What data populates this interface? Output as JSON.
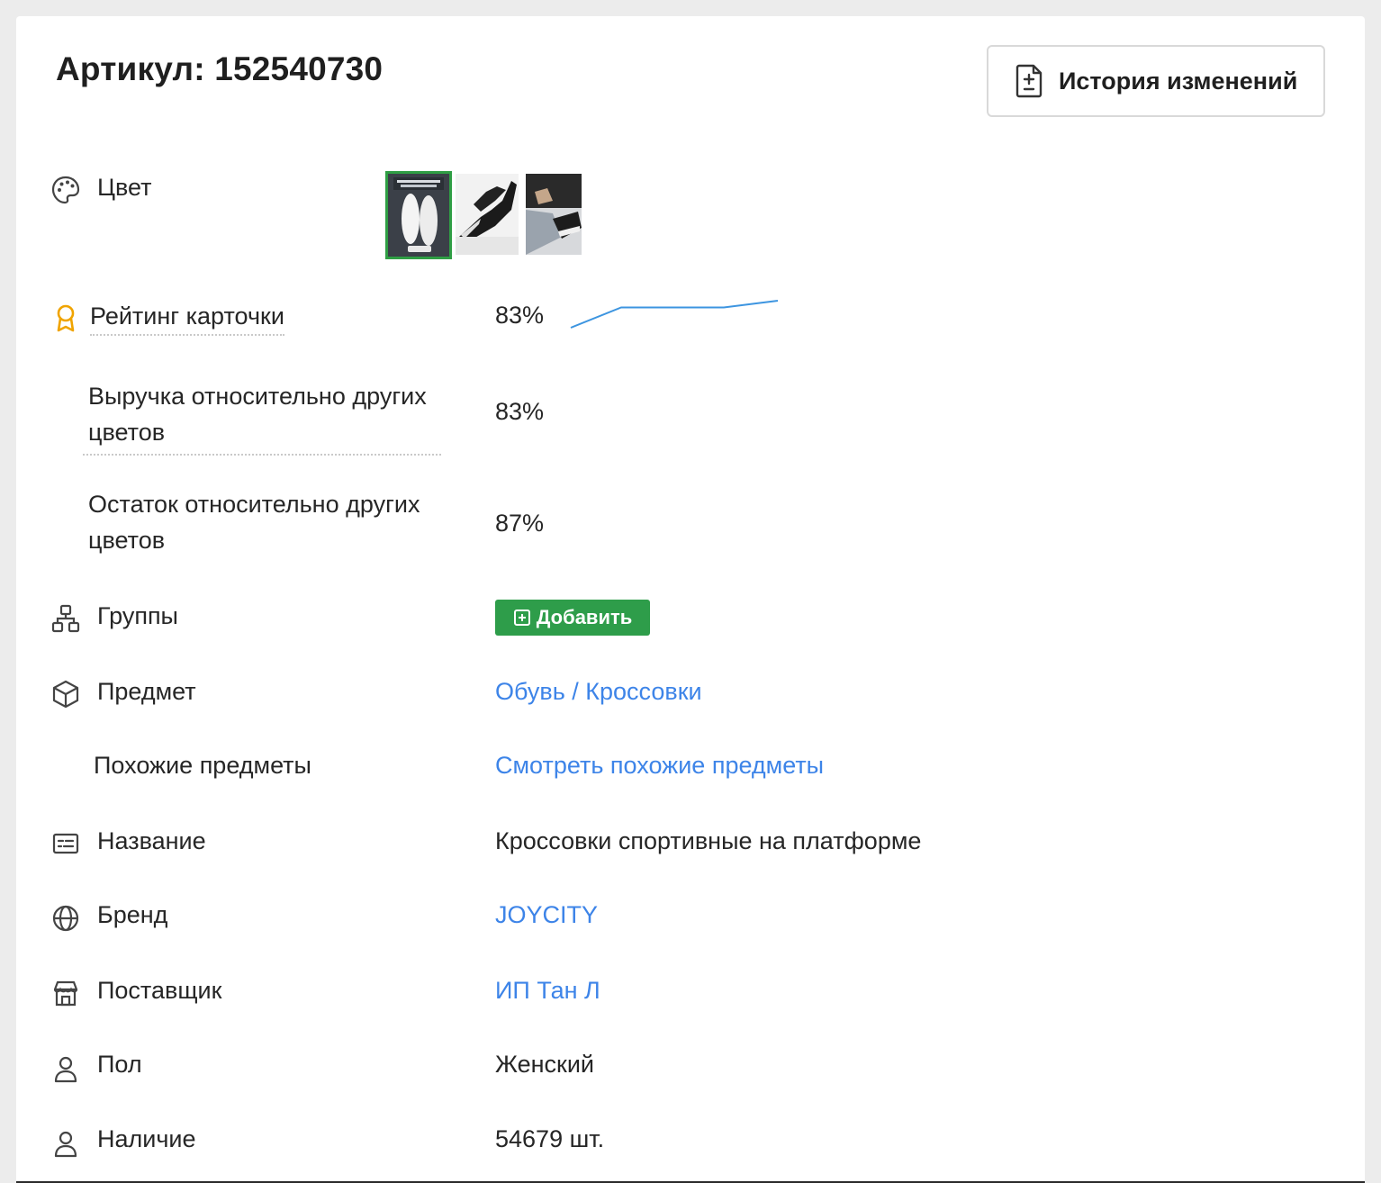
{
  "title": "Артикул: 152540730",
  "history_button": {
    "label": "История изменений",
    "icon": "file-plus-minus-icon"
  },
  "color": {
    "label": "Цвет",
    "icon": "palette-icon",
    "thumbnails": [
      "thumb-product-box",
      "thumb-black-sneakers-feet",
      "thumb-sneakers-lacing"
    ],
    "selected_index": 0,
    "selected_color": "#2f9e44"
  },
  "rating": {
    "label": "Рейтинг карточки",
    "icon": "award-icon",
    "value": "83%",
    "trend": [
      0.0,
      0.75,
      0.75,
      1.0
    ],
    "trend_color": "#3d95e0"
  },
  "revenue_rel": {
    "label": "Выручка относительно других цветов",
    "value": "83%"
  },
  "stock_rel": {
    "label": "Остаток относительно других цветов",
    "value": "87%"
  },
  "groups": {
    "label": "Группы",
    "icon": "hierarchy-icon",
    "add_label": "Добавить",
    "add_color": "#2e9d4a"
  },
  "subject": {
    "label": "Предмет",
    "icon": "box-icon",
    "value": "Обувь / Кроссовки"
  },
  "similar": {
    "label": "Похожие предметы",
    "value": "Смотреть похожие предметы"
  },
  "name": {
    "label": "Название",
    "icon": "id-card-icon",
    "value": "Кроссовки спортивные на платформе"
  },
  "brand": {
    "label": "Бренд",
    "icon": "globe-icon",
    "value": "JOYCITY"
  },
  "supplier": {
    "label": "Поставщик",
    "icon": "store-icon",
    "value": "ИП Тан Л"
  },
  "gender": {
    "label": "Пол",
    "icon": "user-icon",
    "value": "Женский"
  },
  "availability": {
    "label": "Наличие",
    "icon": "user-icon",
    "value": "54679 шт."
  },
  "link_color": "#3d84e8"
}
